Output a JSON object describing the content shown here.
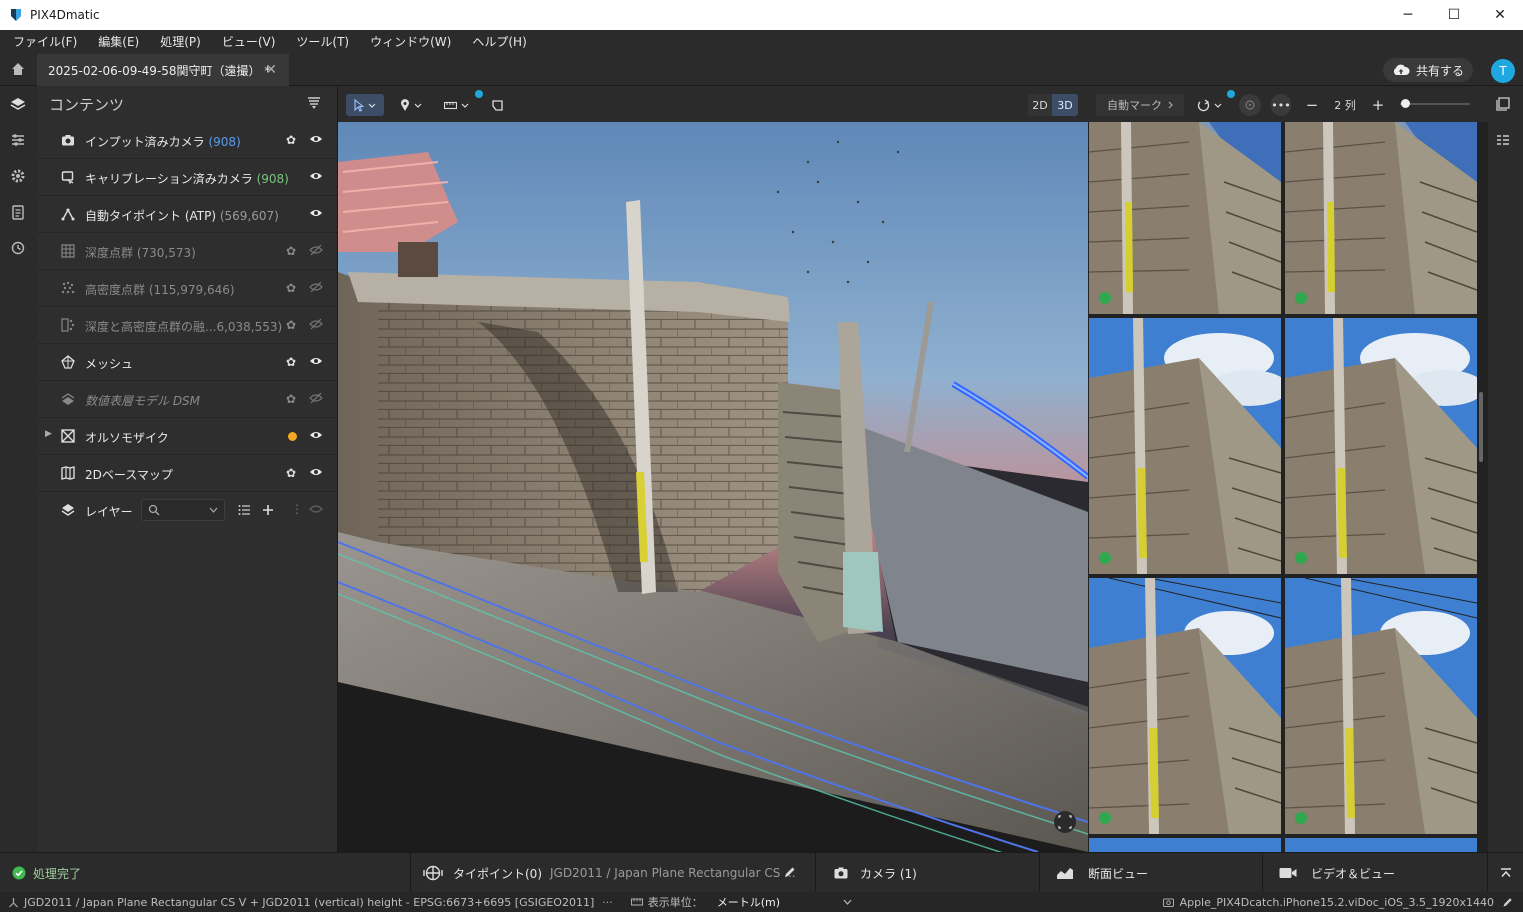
{
  "window": {
    "title": "PIX4Dmatic",
    "minimize": "─",
    "maximize": "☐",
    "close": "✕"
  },
  "menu": [
    "ファイル(F)",
    "編集(E)",
    "処理(P)",
    "ビュー(V)",
    "ツール(T)",
    "ウィンドウ(W)",
    "ヘルプ(H)"
  ],
  "tab": {
    "label": "2025-02-06-09-49-58関守町（遠撮） *",
    "close": "✕"
  },
  "header": {
    "share_label": "共有する",
    "avatar_initial": "T"
  },
  "contents": {
    "title": "コンテンツ",
    "items": [
      {
        "label": "インプット済みカメラ",
        "count": "(908)"
      },
      {
        "label": "キャリブレーション済みカメラ",
        "count": "(908)"
      },
      {
        "label": "自動タイポイント (ATP)",
        "count": "(569,607)"
      },
      {
        "label": "深度点群",
        "count": "(730,573)"
      },
      {
        "label": "高密度点群",
        "count": "(115,979,646)"
      },
      {
        "label": "深度と高密度点群の融...",
        "count": "6,038,553)"
      },
      {
        "label": "メッシュ",
        "count": ""
      },
      {
        "label": "数値表層モデル DSM",
        "count": ""
      },
      {
        "label": "オルソモザイク",
        "count": ""
      },
      {
        "label": "2Dベースマップ",
        "count": ""
      }
    ],
    "layers_label": "レイヤー"
  },
  "viewer": {
    "mode_2d": "2D",
    "mode_3d": "3D"
  },
  "gallery": {
    "automark_label": "自動マーク",
    "columns_label": "2 列",
    "minus": "−",
    "plus": "+"
  },
  "status": {
    "done": "処理完了",
    "tiepoint_label": "タイポイント(0)",
    "crs_short": "JGD2011 / Japan Plane Rectangular CS ...",
    "camera_label": "カメラ (1)",
    "section_label": "断面ビュー",
    "video_label": "ビデオ＆ビュー"
  },
  "footer": {
    "crs_full": "JGD2011 / Japan Plane Rectangular CS V + JGD2011 (vertical) height - EPSG:6673+6695 [GSIGEO2011]",
    "unit_label": "表示単位：",
    "unit_value": "メートル(m)",
    "camera_file": "Apple_PIX4Dcatch.iPhone15.2.viDoc_iOS_3.5_1920x1440"
  },
  "colors": {
    "accent": "#1fa8e0",
    "count_blue": "#5b9cf0",
    "count_green": "#7bc47f",
    "status_green": "#3fb950",
    "ortho_dot": "#f5a623"
  }
}
